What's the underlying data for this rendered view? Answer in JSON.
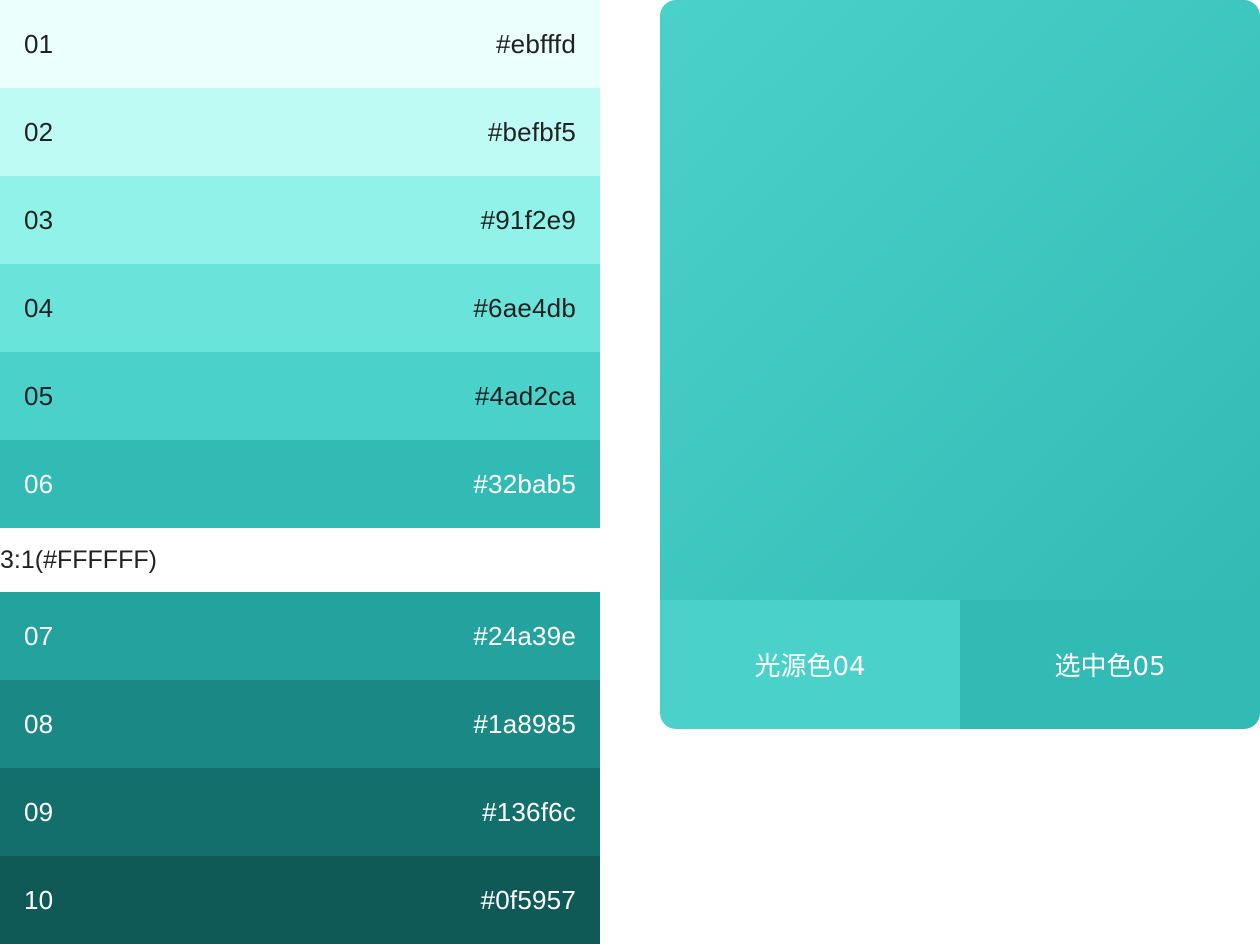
{
  "palette_top": [
    {
      "index": "01",
      "hex": "#ebfffd",
      "bg": "#ebfffd",
      "fg": "#222222"
    },
    {
      "index": "02",
      "hex": "#befbf5",
      "bg": "#befbf5",
      "fg": "#222222"
    },
    {
      "index": "03",
      "hex": "#91f2e9",
      "bg": "#91f2e9",
      "fg": "#222222"
    },
    {
      "index": "04",
      "hex": "#6ae4db",
      "bg": "#6ae4db",
      "fg": "#222222"
    },
    {
      "index": "05",
      "hex": "#4ad2ca",
      "bg": "#4ad2ca",
      "fg": "#222222"
    },
    {
      "index": "06",
      "hex": "#32bab5",
      "bg": "#32bab5",
      "fg": "#ffffff"
    }
  ],
  "contrast_label": "3:1(#FFFFFF)",
  "palette_bottom": [
    {
      "index": "07",
      "hex": "#24a39e",
      "bg": "#24a39e",
      "fg": "#ffffff"
    },
    {
      "index": "08",
      "hex": "#1a8985",
      "bg": "#1a8985",
      "fg": "#ffffff"
    },
    {
      "index": "09",
      "hex": "#136f6c",
      "bg": "#136f6c",
      "fg": "#ffffff"
    },
    {
      "index": "10",
      "hex": "#0f5957",
      "bg": "#0f5957",
      "fg": "#ffffff"
    }
  ],
  "preview": {
    "gradient_start": "#4ad2ca",
    "gradient_end": "#32bab5",
    "light_label": "光源色04",
    "light_color": "#4ad2ca",
    "selected_label": "选中色05",
    "selected_color": "#32bab5",
    "label_color": "#ffffff"
  }
}
